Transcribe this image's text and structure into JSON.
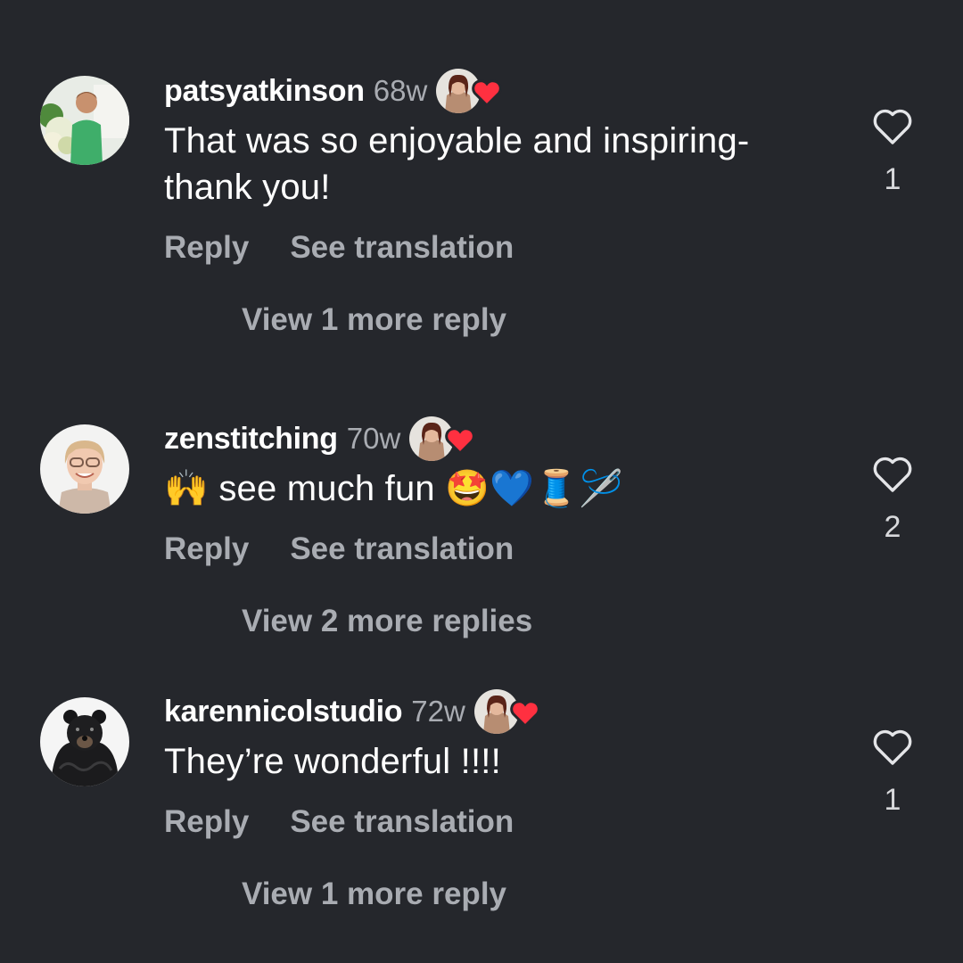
{
  "comments": [
    {
      "username": "patsyatkinson",
      "time": "68w",
      "text": "That was so enjoyable and inspiring-thank you!",
      "text_lines": [
        "That was so enjoyable and inspiring-",
        "thank you!"
      ],
      "reply_label": "Reply",
      "translate_label": "See translation",
      "view_more": "View 1 more reply",
      "like_count": "1",
      "avatar_icon": "woman-with-flowers-avatar",
      "liked_by_icon": "creator-avatar-with-heart"
    },
    {
      "username": "zenstitching",
      "time": "70w",
      "text": "🙌 see much fun 🤩💙🧵🪡",
      "text_lines": [
        "🙌 see much fun 🤩💙🧵🪡"
      ],
      "reply_label": "Reply",
      "translate_label": "See translation",
      "view_more": "View 2 more replies",
      "like_count": "2",
      "avatar_icon": "smiling-woman-glasses-avatar",
      "liked_by_icon": "creator-avatar-with-heart"
    },
    {
      "username": "karennicolstudio",
      "time": "72w",
      "text": "They’re wonderful !!!!",
      "text_lines": [
        "They’re wonderful !!!!"
      ],
      "reply_label": "Reply",
      "translate_label": "See translation",
      "view_more": "View 1 more reply",
      "like_count": "1",
      "avatar_icon": "bear-avatar",
      "liked_by_icon": "creator-avatar-with-heart"
    }
  ],
  "colors": {
    "background": "#25272c",
    "primary_text": "#ffffff",
    "secondary_text": "#a9acb2",
    "heart_red": "#ff3040"
  }
}
